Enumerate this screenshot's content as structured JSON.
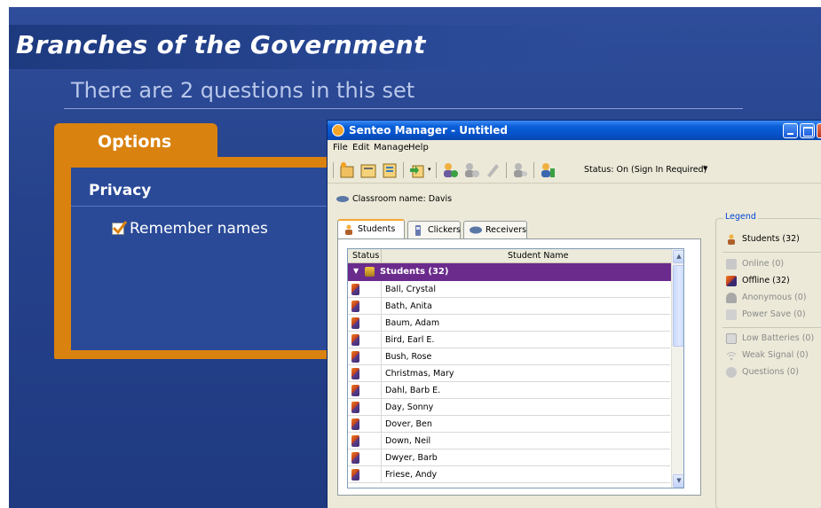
{
  "slide": {
    "title": "Branches of the Government",
    "subtitle": "There are 2 questions in this set",
    "options_tab": "Options",
    "privacy_label": "Privacy",
    "remember_label": "Remember names",
    "remember_checked": true
  },
  "window": {
    "title": "Senteo Manager - Untitled",
    "menu": [
      "File",
      "Edit",
      "Manage",
      "Help"
    ],
    "status": "Status: On (Sign In Required)",
    "classroom": "Classroom name: Davis",
    "tabs": [
      "Students",
      "Clickers",
      "Receivers"
    ],
    "table": {
      "headers": {
        "status": "Status",
        "name": "Student Name"
      },
      "group": "Students (32)",
      "rows": [
        "Ball, Crystal",
        "Bath, Anita",
        "Baum, Adam",
        "Bird, Earl E.",
        "Bush, Rose",
        "Christmas, Mary",
        "Dahl, Barb E.",
        "Day, Sonny",
        "Dover, Ben",
        "Down, Neil",
        "Dwyer, Barb",
        "Friese, Andy"
      ]
    },
    "legend": {
      "title": "Legend",
      "students": "Students (32)",
      "online": "Online (0)",
      "offline": "Offline (32)",
      "anonymous": "Anonymous (0)",
      "power_save": "Power Save (0)",
      "low_batteries": "Low Batteries (0)",
      "weak_signal": "Weak Signal (0)",
      "questions": "Questions (0)"
    }
  },
  "colors": {
    "slide_bg": "#26428c",
    "accent_orange": "#d9820f",
    "group_purple": "#6b2b8c",
    "titlebar_blue": "#0752c9"
  }
}
